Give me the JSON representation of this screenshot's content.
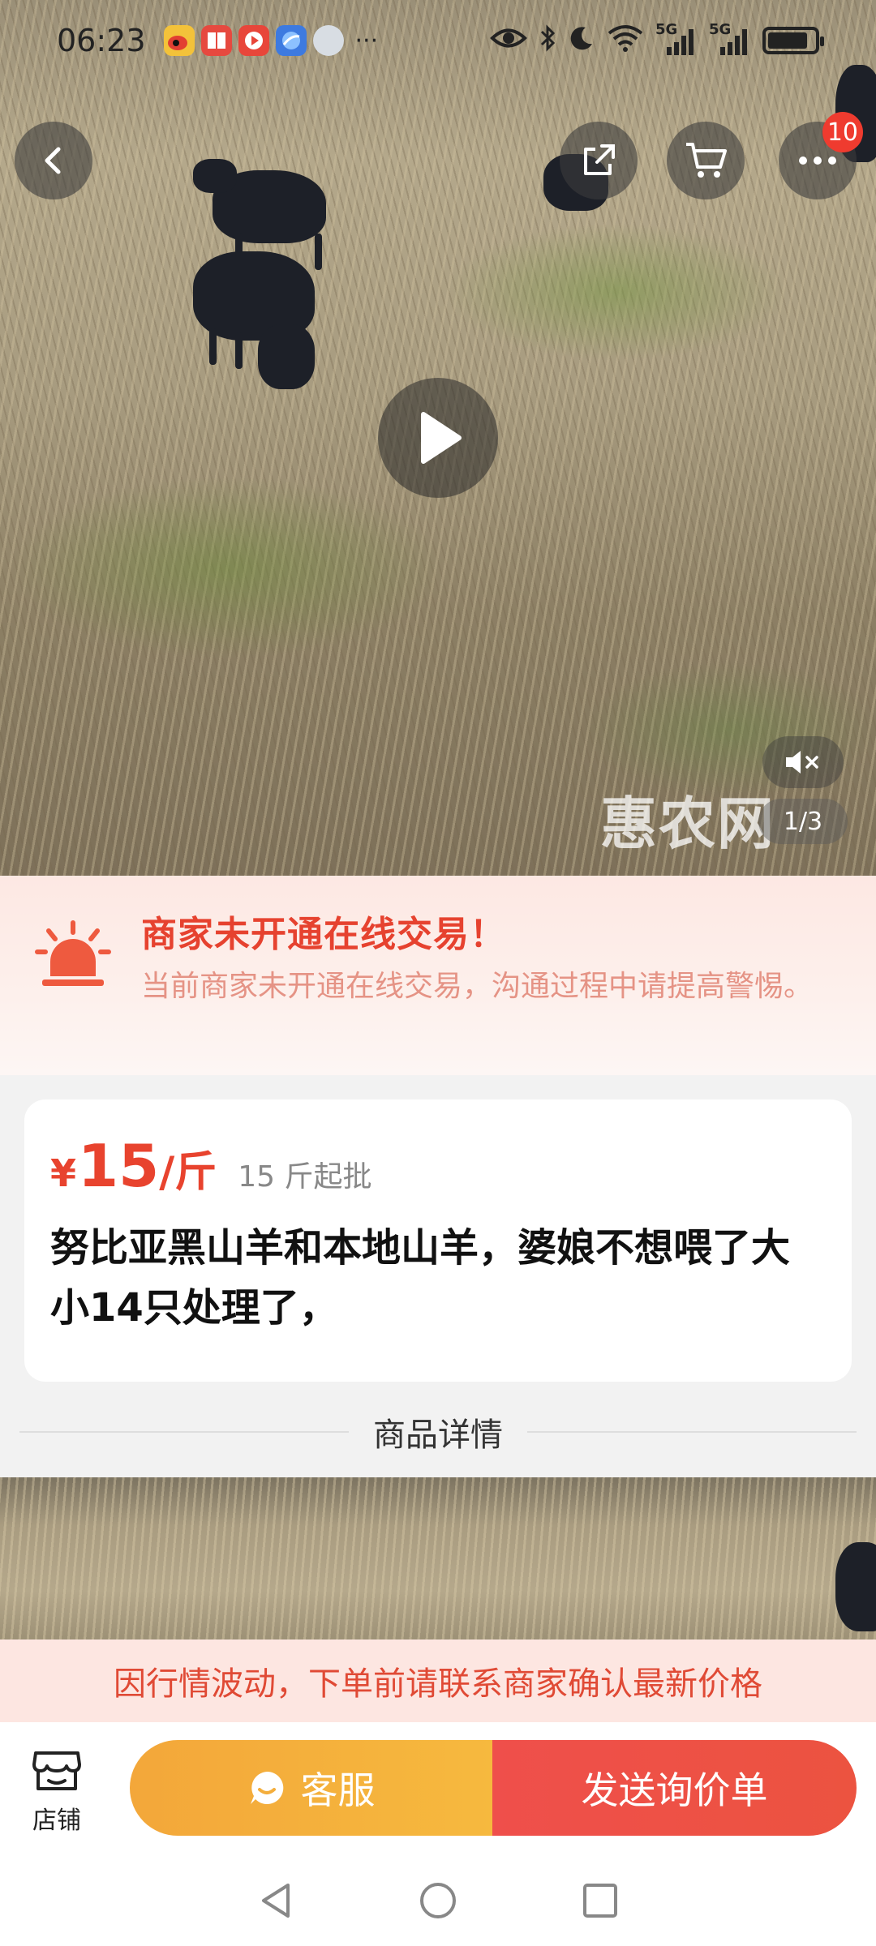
{
  "status_bar": {
    "time": "06:23",
    "more_indicator": "···",
    "network_labels": [
      "5G",
      "5G"
    ],
    "battery_level": 0.85,
    "icons": [
      "weibo-icon",
      "book-icon",
      "video-icon",
      "browser-icon",
      "weather-icon",
      "eye-icon",
      "bluetooth-icon",
      "moon-icon",
      "wifi-icon",
      "signal-icon",
      "signal-icon",
      "battery-icon"
    ]
  },
  "top_bar": {
    "back_icon": "back-icon",
    "share_icon": "share-icon",
    "cart_icon": "cart-icon",
    "more_icon": "more-icon",
    "more_badge": "10"
  },
  "media": {
    "page_indicator": "1/3",
    "watermark": "惠农网",
    "play_icon": "play-icon",
    "mute_icon": "mute-icon"
  },
  "warning": {
    "title": "商家未开通在线交易！",
    "text": "当前商家未开通在线交易，沟通过程中请提高警惕。",
    "color": "#e6422f"
  },
  "product": {
    "currency": "¥",
    "price": "15",
    "unit": "/斤",
    "min_order": "15 斤起批",
    "title": "努比亚黑山羊和本地山羊，婆娘不想喂了大小14只处理了，",
    "price_color": "#e8432e"
  },
  "section": {
    "detail_label": "商品详情"
  },
  "notice": {
    "text": "因行情波动，下单前请联系商家确认最新价格"
  },
  "actions": {
    "shop_label": "店铺",
    "service_label": "客服",
    "inquiry_label": "发送询价单",
    "service_color": "#f4ae3c",
    "inquiry_color": "#ed5046"
  },
  "nav": {
    "icons": [
      "nav-back-icon",
      "nav-home-icon",
      "nav-recents-icon"
    ]
  }
}
